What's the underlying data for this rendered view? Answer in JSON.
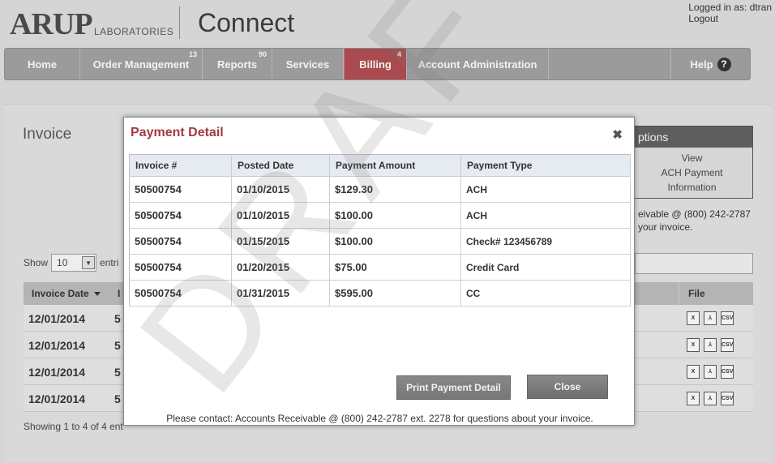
{
  "header": {
    "logo_text": "ARUP",
    "logo_sub": "LABORATORIES",
    "app_title": "Connect",
    "logged_in": "Logged in as: dtran",
    "logout": "Logout"
  },
  "nav": {
    "items": [
      {
        "label": "Home",
        "badge": ""
      },
      {
        "label": "Order Management",
        "badge": "13"
      },
      {
        "label": "Reports",
        "badge": "90"
      },
      {
        "label": "Services",
        "badge": ""
      },
      {
        "label": "Billing",
        "badge": "4"
      },
      {
        "label": "Account Administration",
        "badge": ""
      }
    ],
    "help": "Help",
    "help_icon": "?"
  },
  "page": {
    "title": "Invoice",
    "options_header": "ptions",
    "options_links": [
      "View",
      "ACH Payment",
      "Information"
    ],
    "contact_partial_1": "eivable @ (800) 242-2787",
    "contact_partial_2": "your invoice.",
    "show_label": "Show",
    "show_value": "10",
    "show_suffix": "entri",
    "table_head_date": "Invoice Date",
    "table_head_i": "I",
    "table_head_file": "File",
    "rows": [
      {
        "date": "12/01/2014",
        "num": "5"
      },
      {
        "date": "12/01/2014",
        "num": "5"
      },
      {
        "date": "12/01/2014",
        "num": "5"
      },
      {
        "date": "12/01/2014",
        "num": "5"
      }
    ],
    "showing": "Showing 1 to 4 of 4 ent"
  },
  "modal": {
    "title": "Payment Detail",
    "close_icon": "✖",
    "columns": [
      "Invoice #",
      "Posted Date",
      "Payment Amount",
      "Payment Type"
    ],
    "rows": [
      {
        "invoice": "50500754",
        "date": "01/10/2015",
        "amount": "$129.30",
        "type": "ACH"
      },
      {
        "invoice": "50500754",
        "date": "01/10/2015",
        "amount": "$100.00",
        "type": "ACH"
      },
      {
        "invoice": "50500754",
        "date": "01/15/2015",
        "amount": "$100.00",
        "type": "Check# 123456789"
      },
      {
        "invoice": "50500754",
        "date": "01/20/2015",
        "amount": "$75.00",
        "type": "Credit Card"
      },
      {
        "invoice": "50500754",
        "date": "01/31/2015",
        "amount": "$595.00",
        "type": "CC"
      }
    ],
    "print_button": "Print Payment Detail",
    "close_button": "Close",
    "contact": "Please contact: Accounts Receivable @ (800) 242-2787 ext. 2278 for questions about your invoice."
  },
  "watermark": "DRAFT",
  "colors": {
    "accent": "#a84a4f",
    "modal_title": "#a33a40",
    "nav_bg": "#9b9b9b"
  }
}
